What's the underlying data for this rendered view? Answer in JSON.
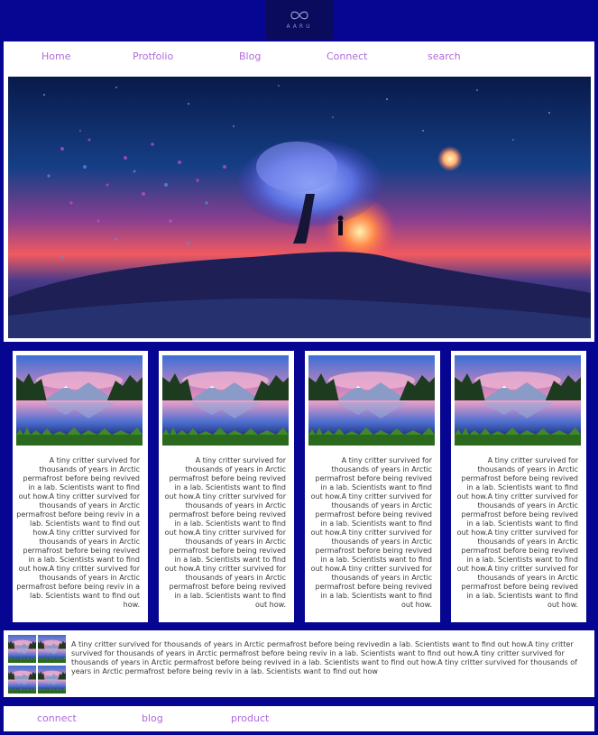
{
  "logo": {
    "text": "AARU"
  },
  "nav": {
    "home": "Home",
    "portfolio": "Protfolio",
    "blog": "Blog",
    "connect": "Connect",
    "search": "search"
  },
  "cards": [
    {
      "text": "A tiny critter survived for thousands of years in Arctic permafrost before being revived in a lab. Scientists want to find out how.A tiny critter survived for thousands of years in Arctic permafrost before being reviv in a lab. Scientists want to find out how.A tiny critter survived for thousands of years in Arctic permafrost before being revived in a lab. Scientists want to find out how.A tiny critter survived for thousands of years in Arctic permafrost before being reviv in a lab. Scientists want to find out how."
    },
    {
      "text": "A tiny critter survived for thousands of years in Arctic permafrost before being revived in a lab. Scientists want to find out how.A tiny critter survived for thousands of years in Arctic permafrost before being revived in a lab. Scientists want to find out how.A tiny critter survived for thousands of years in Arctic permafrost before being revived in a lab. Scientists want to find out how.A tiny critter survived for thousands of years in Arctic permafrost before being revived in a lab. Scientists want to find out how."
    },
    {
      "text": "A tiny critter survived for thousands of years in Arctic permafrost before being revived in a lab. Scientists want to find out how.A tiny critter survived for thousands of years in Arctic permafrost before being revived in a lab. Scientists want to find out how.A tiny critter survived for thousands of years in Arctic permafrost before being revived in a lab. Scientists want to find out how.A tiny critter survived for thousands of years in Arctic permafrost before being revived in a lab. Scientists want to find out how."
    },
    {
      "text": "A tiny critter survived for thousands of years in Arctic permafrost before being revived in a lab. Scientists want to find out how.A tiny critter survived for thousands of years in Arctic permafrost before being revived in a lab. Scientists want to find out how.A tiny critter survived for thousands of years in Arctic permafrost before being revived in a lab. Scientists want to find out how.A tiny critter survived for thousands of years in Arctic permafrost before being revived in a lab. Scientists want to find out how."
    }
  ],
  "strip": {
    "text": "A tiny critter survived for thousands of years in Arctic permafrost before being revivedin a lab. Scientists want to find out how.A tiny critter survived for thousands of years in Arctic permafrost before being reviv in a lab. Scientists want to find out how.A tiny critter survived for thousands of years in Arctic permafrost before being revived in a lab. Scientists want to find out how.A tiny critter survived for thousands of years in Arctic permafrost before being reviv in a lab. Scientists want to find out how"
  },
  "footer": {
    "connect": "connect",
    "blog": "blog",
    "product": "product"
  },
  "colors": {
    "background": "#060693",
    "link": "#b06bd9",
    "panel": "#ffffff"
  }
}
